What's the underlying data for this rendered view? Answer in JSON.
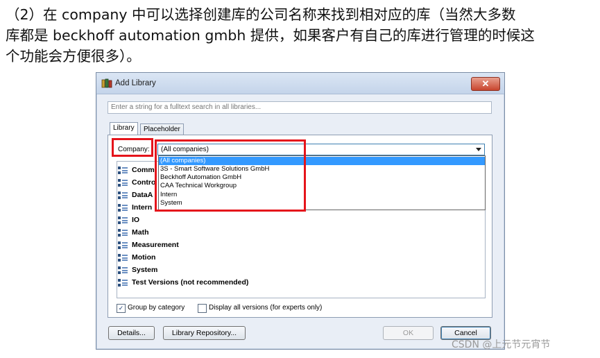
{
  "intro": {
    "line1": "（2）在 company 中可以选择创建库的公司名称来找到相对应的库（当然大多数",
    "line2": "库都是 beckhoff automation gmbh 提供，如果客户有自己的库进行管理的时候这",
    "line3": "个功能会方便很多）。"
  },
  "dialog": {
    "title": "Add Library",
    "close_label": "✕",
    "search_placeholder": "Enter a string for a fulltext search in all libraries...",
    "tabs": [
      {
        "label": "Library"
      },
      {
        "label": "Placeholder"
      }
    ],
    "company_label": "Company:",
    "company_selected": "(All companies)",
    "company_options": [
      "(All companies)",
      "3S - Smart Software Solutions GmbH",
      "Beckhoff Automation GmbH",
      "CAA Technical Workgroup",
      "Intern",
      "System"
    ],
    "categories": [
      "Comm",
      "Contro",
      "DataA",
      "Intern",
      "IO",
      "Math",
      "Measurement",
      "Motion",
      "System",
      "Test Versions (not recommended)"
    ],
    "group_by_category": {
      "label": "Group by category",
      "checked": true
    },
    "display_all_versions": {
      "label": "Display all versions (for experts only)",
      "checked": false
    },
    "buttons": {
      "details": "Details...",
      "library_repository": "Library Repository...",
      "ok": "OK",
      "cancel": "Cancel"
    }
  },
  "watermark": "CSDN @上元节元宵节"
}
